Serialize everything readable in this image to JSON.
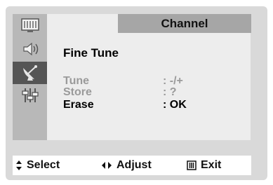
{
  "menu": {
    "title": "Channel",
    "heading": "Fine Tune",
    "rows": [
      {
        "label": "Tune",
        "value": ":  -/+",
        "enabled": false
      },
      {
        "label": "Store",
        "value": ":  ?",
        "enabled": false
      },
      {
        "label": "Erase",
        "value": ": OK",
        "enabled": true
      }
    ]
  },
  "sidebar": {
    "items": [
      {
        "icon": "picture-icon",
        "selected": false
      },
      {
        "icon": "speaker-icon",
        "selected": false
      },
      {
        "icon": "satellite-dish-icon",
        "selected": true
      },
      {
        "icon": "equalizer-icon",
        "selected": false
      }
    ]
  },
  "footer": {
    "select_label": "Select",
    "adjust_label": "Adjust",
    "exit_label": "Exit",
    "select_icon": "up-down-arrows-icon",
    "adjust_icon": "left-right-arrows-icon",
    "exit_icon": "menu-icon"
  },
  "colors": {
    "panel": "#d9d9d9",
    "sidebar": "#b8b8b8",
    "sidebar_selected": "#555555",
    "title_bar": "#a6a6a6",
    "disabled_text": "#9a9a9a"
  }
}
